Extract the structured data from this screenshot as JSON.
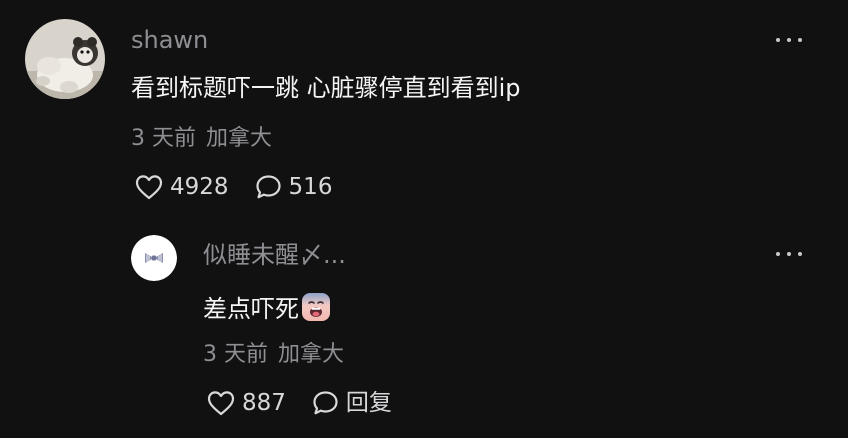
{
  "comments": [
    {
      "username": "shawn",
      "text": "看到标题吓一跳 心脏骤停直到看到ip",
      "time": "3 天前",
      "location": "加拿大",
      "likes": "4928",
      "replies": "516",
      "avatar_icon": "teddy-bear-avatar"
    }
  ],
  "reply": {
    "username": "似睡未醒〆...",
    "text": "差点吓死",
    "emoji_icon": "anguished-face-emoji",
    "time": "3 天前",
    "location": "加拿大",
    "likes": "887",
    "reply_label": "回复",
    "avatar_icon": "bow-avatar"
  },
  "colors": {
    "background": "#111112",
    "muted_text": "#8e8e93",
    "primary_text": "#f5f5f5"
  }
}
